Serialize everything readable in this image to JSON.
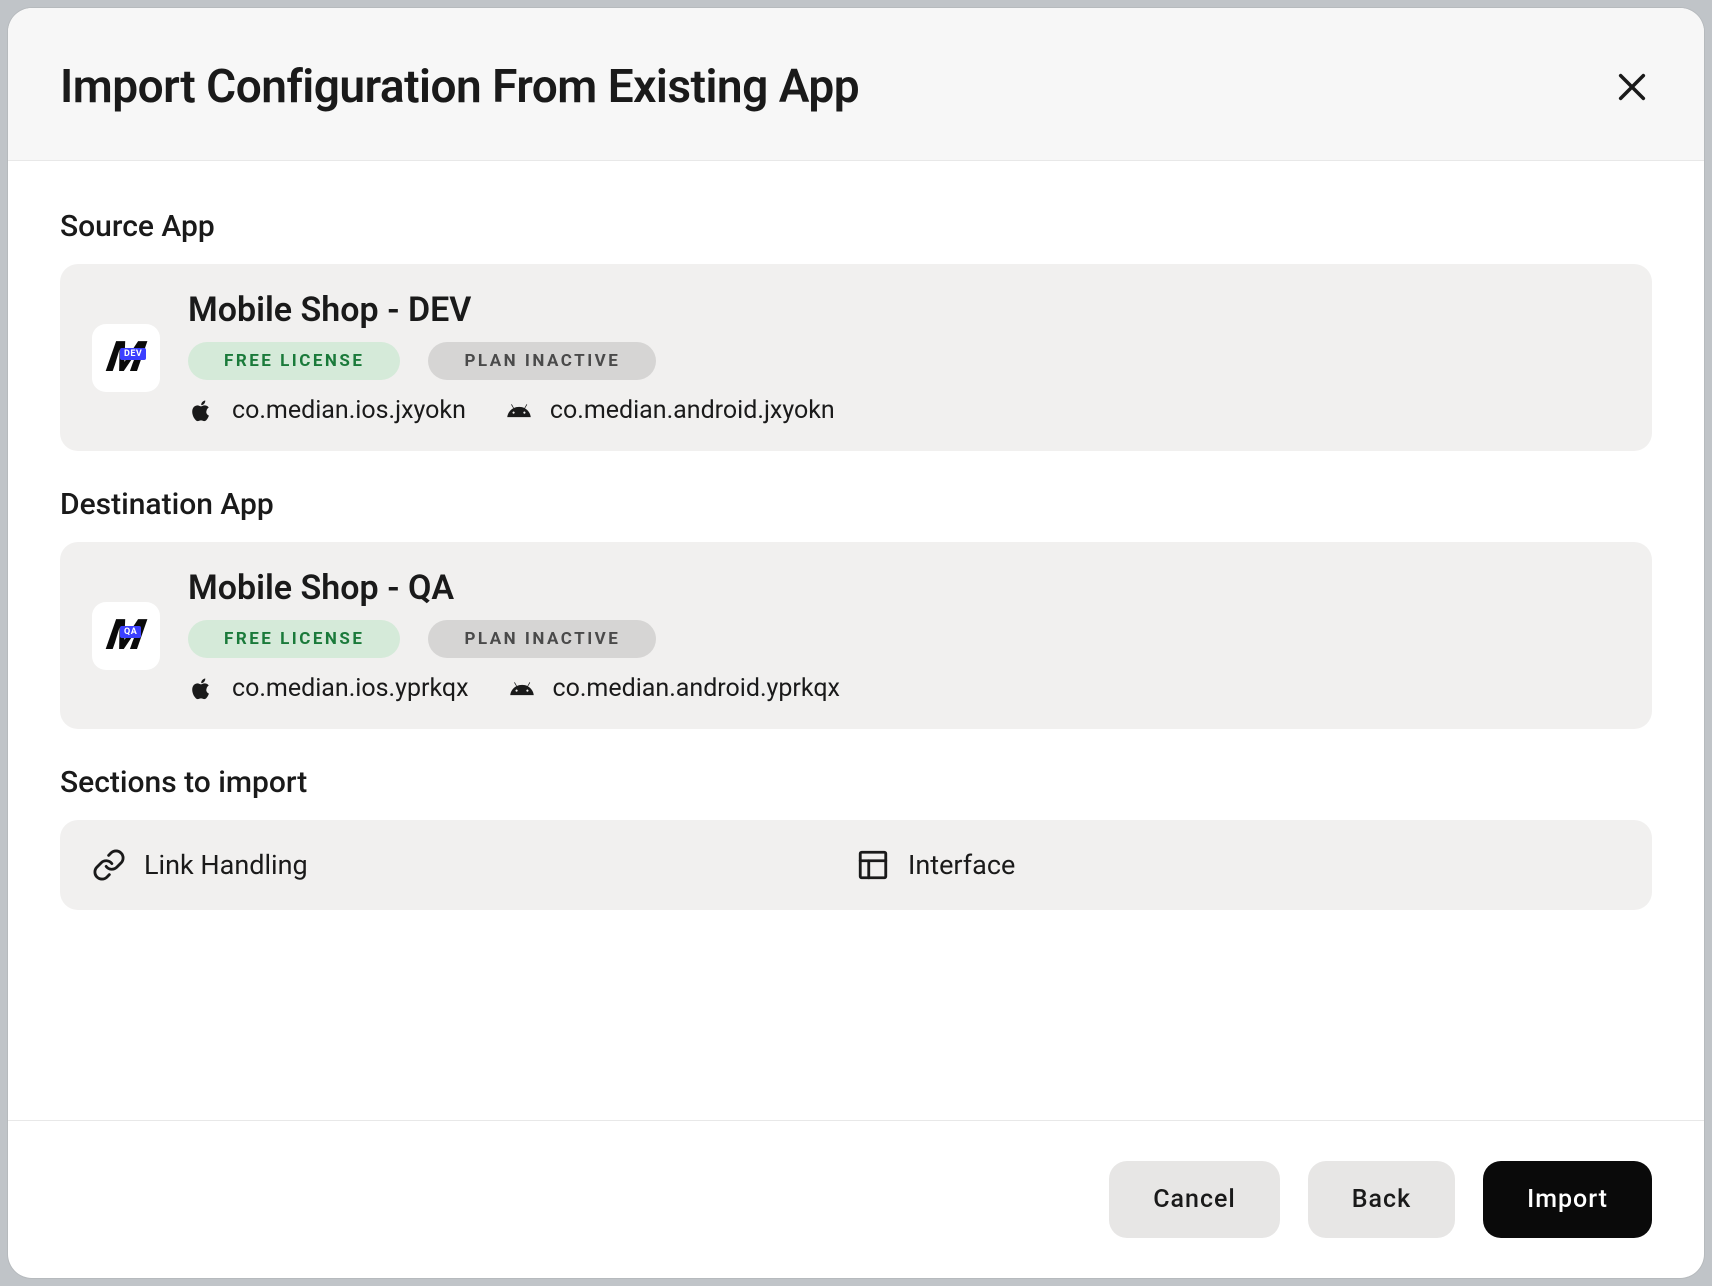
{
  "modal": {
    "title": "Import Configuration From Existing App"
  },
  "source": {
    "label": "Source App",
    "app": {
      "name": "Mobile Shop - DEV",
      "iconBadge": "DEV",
      "licenseBadge": "FREE LICENSE",
      "planBadge": "PLAN INACTIVE",
      "iosId": "co.median.ios.jxyokn",
      "androidId": "co.median.android.jxyokn"
    }
  },
  "destination": {
    "label": "Destination App",
    "app": {
      "name": "Mobile Shop - QA",
      "iconBadge": "QA",
      "licenseBadge": "FREE LICENSE",
      "planBadge": "PLAN INACTIVE",
      "iosId": "co.median.ios.yprkqx",
      "androidId": "co.median.android.yprkqx"
    }
  },
  "sections": {
    "label": "Sections to import",
    "items": [
      {
        "name": "Link Handling"
      },
      {
        "name": "Interface"
      }
    ]
  },
  "footer": {
    "cancel": "Cancel",
    "back": "Back",
    "import": "Import"
  }
}
